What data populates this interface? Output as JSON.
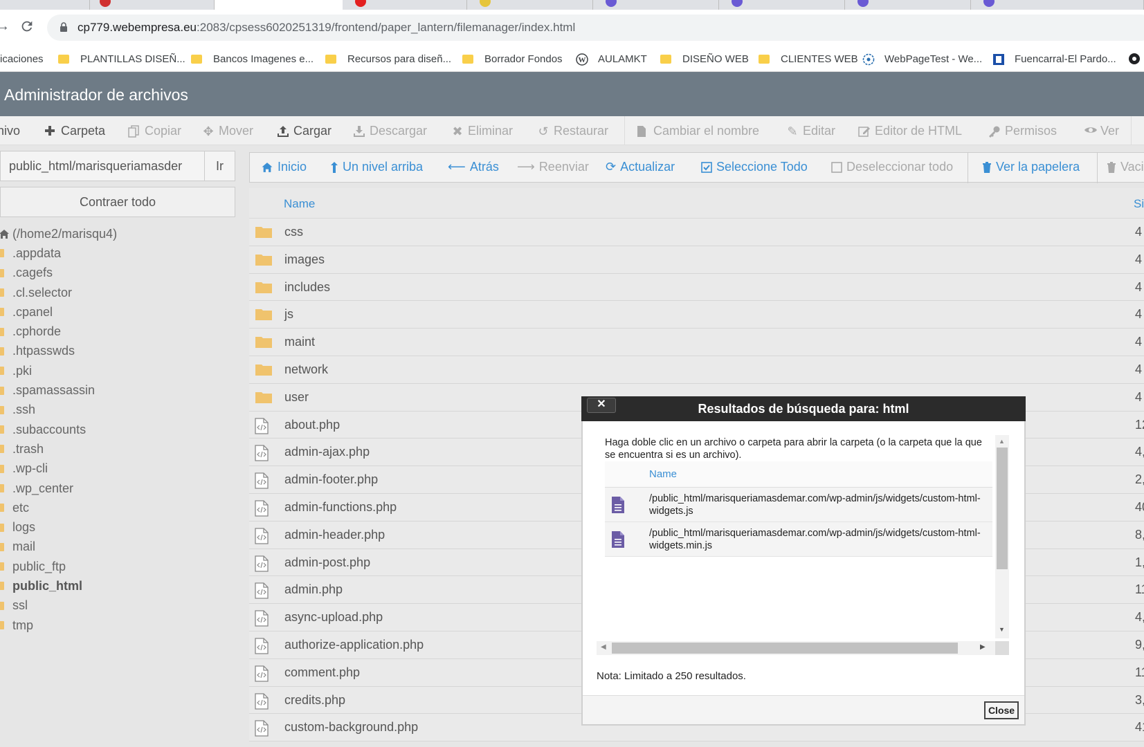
{
  "browser": {
    "url_host": "cp779.webempresa.eu",
    "url_path": ":2083/cpsess6020251319/frontend/paper_lantern/filemanager/index.html",
    "bookmarks": [
      {
        "label": "icaciones",
        "icon": "folder"
      },
      {
        "label": "PLANTILLAS DISEÑ...",
        "icon": "folder"
      },
      {
        "label": "Bancos Imagenes e...",
        "icon": "folder"
      },
      {
        "label": "Recursos para diseñ...",
        "icon": "folder"
      },
      {
        "label": "Borrador Fondos",
        "icon": "folder"
      },
      {
        "label": "AULAMKT",
        "icon": "wordpress-icon"
      },
      {
        "label": "DISEÑO WEB",
        "icon": "folder"
      },
      {
        "label": "CLIENTES WEB",
        "icon": "folder"
      },
      {
        "label": "WebPageTest - We...",
        "icon": "webpagetest-icon"
      },
      {
        "label": "Fuencarral-El Pardo...",
        "icon": "madrid-icon"
      }
    ]
  },
  "header": {
    "title": "Administrador de archivos"
  },
  "toolbar": {
    "items": [
      {
        "label": "hivo",
        "icon": "",
        "enabled": true
      },
      {
        "label": "Carpeta",
        "icon": "plus-icon",
        "enabled": true
      },
      {
        "label": "Copiar",
        "icon": "copy-icon",
        "enabled": false
      },
      {
        "label": "Mover",
        "icon": "move-icon",
        "enabled": false
      },
      {
        "label": "Cargar",
        "icon": "upload-icon",
        "enabled": true
      },
      {
        "label": "Descargar",
        "icon": "download-icon",
        "enabled": false
      },
      {
        "label": "Eliminar",
        "icon": "x-icon",
        "enabled": false
      },
      {
        "label": "Restaurar",
        "icon": "undo-icon",
        "enabled": false
      },
      {
        "label": "Cambiar el nombre",
        "icon": "file-icon",
        "enabled": false
      },
      {
        "label": "Editar",
        "icon": "pencil-icon",
        "enabled": false
      },
      {
        "label": "Editor de HTML",
        "icon": "edit-square-icon",
        "enabled": false
      },
      {
        "label": "Permisos",
        "icon": "key-icon",
        "enabled": false
      },
      {
        "label": "Ver",
        "icon": "eye-icon",
        "enabled": false
      }
    ]
  },
  "sidebar": {
    "path_value": "public_html/marisqueriamasder",
    "go_label": "Ir",
    "collapse_label": "Contraer todo",
    "root_label": "(/home2/marisqu4)",
    "tree": [
      {
        "label": ".appdata",
        "bold": false
      },
      {
        "label": ".cagefs",
        "bold": false
      },
      {
        "label": ".cl.selector",
        "bold": false
      },
      {
        "label": ".cpanel",
        "bold": false
      },
      {
        "label": ".cphorde",
        "bold": false
      },
      {
        "label": ".htpasswds",
        "bold": false
      },
      {
        "label": ".pki",
        "bold": false
      },
      {
        "label": ".spamassassin",
        "bold": false
      },
      {
        "label": ".ssh",
        "bold": false
      },
      {
        "label": ".subaccounts",
        "bold": false
      },
      {
        "label": ".trash",
        "bold": false
      },
      {
        "label": ".wp-cli",
        "bold": false
      },
      {
        "label": ".wp_center",
        "bold": false
      },
      {
        "label": "etc",
        "bold": false
      },
      {
        "label": "logs",
        "bold": false
      },
      {
        "label": "mail",
        "bold": false
      },
      {
        "label": "public_ftp",
        "bold": false
      },
      {
        "label": "public_html",
        "bold": true
      },
      {
        "label": "ssl",
        "bold": false
      },
      {
        "label": "tmp",
        "bold": false
      }
    ]
  },
  "navbar": {
    "items": [
      {
        "label": "Inicio",
        "icon": "home-icon",
        "enabled": true
      },
      {
        "label": "Un nivel arriba",
        "icon": "level-up-icon",
        "enabled": true
      },
      {
        "label": "Atrás",
        "icon": "arrow-left-icon",
        "enabled": true
      },
      {
        "label": "Reenviar",
        "icon": "arrow-right-icon",
        "enabled": false
      },
      {
        "label": "Actualizar",
        "icon": "refresh-icon",
        "enabled": true
      },
      {
        "label": "Seleccione Todo",
        "icon": "checkbox-checked-icon",
        "enabled": true
      },
      {
        "label": "Deseleccionar todo",
        "icon": "checkbox-empty-icon",
        "enabled": false
      },
      {
        "label": "Ver la papelera",
        "icon": "trash-icon",
        "enabled": true
      },
      {
        "label": "Vaci",
        "icon": "trash-icon",
        "enabled": false
      }
    ]
  },
  "files": {
    "col_name": "Name",
    "col_size": "Si",
    "rows": [
      {
        "name": "css",
        "type": "folder",
        "size": "4"
      },
      {
        "name": "images",
        "type": "folder",
        "size": "4"
      },
      {
        "name": "includes",
        "type": "folder",
        "size": "4"
      },
      {
        "name": "js",
        "type": "folder",
        "size": "4"
      },
      {
        "name": "maint",
        "type": "folder",
        "size": "4"
      },
      {
        "name": "network",
        "type": "folder",
        "size": "4"
      },
      {
        "name": "user",
        "type": "folder",
        "size": "4"
      },
      {
        "name": "about.php",
        "type": "code",
        "size": "12"
      },
      {
        "name": "admin-ajax.php",
        "type": "code",
        "size": "4,"
      },
      {
        "name": "admin-footer.php",
        "type": "code",
        "size": "2,"
      },
      {
        "name": "admin-functions.php",
        "type": "code",
        "size": "40"
      },
      {
        "name": "admin-header.php",
        "type": "code",
        "size": "8,"
      },
      {
        "name": "admin-post.php",
        "type": "code",
        "size": "1,"
      },
      {
        "name": "admin.php",
        "type": "code",
        "size": "11"
      },
      {
        "name": "async-upload.php",
        "type": "code",
        "size": "4,"
      },
      {
        "name": "authorize-application.php",
        "type": "code",
        "size": "9,"
      },
      {
        "name": "comment.php",
        "type": "code",
        "size": "11"
      },
      {
        "name": "credits.php",
        "type": "code",
        "size": "3,"
      },
      {
        "name": "custom-background.php",
        "type": "code",
        "size": "41"
      }
    ]
  },
  "dialog": {
    "title": "Resultados de búsqueda para: html",
    "close_x": "✕",
    "description": "Haga doble clic en un archivo o carpeta para abrir la carpeta (o la carpeta que la que se encuentra si es un archivo).",
    "col_name": "Name",
    "results": [
      {
        "path": "/public_html/marisqueriamasdemar.com/wp-admin/js/widgets/custom-html-widgets.js"
      },
      {
        "path": "/public_html/marisqueriamasdemar.com/wp-admin/js/widgets/custom-html-widgets.min.js"
      }
    ],
    "note": "Nota: Limitado a 250 resultados.",
    "close_label": "Close"
  },
  "colors": {
    "header_bg": "#6e7b86",
    "link": "#3a8fd4",
    "folder": "#f0c36d",
    "file_icon": "#6b5ca5"
  }
}
